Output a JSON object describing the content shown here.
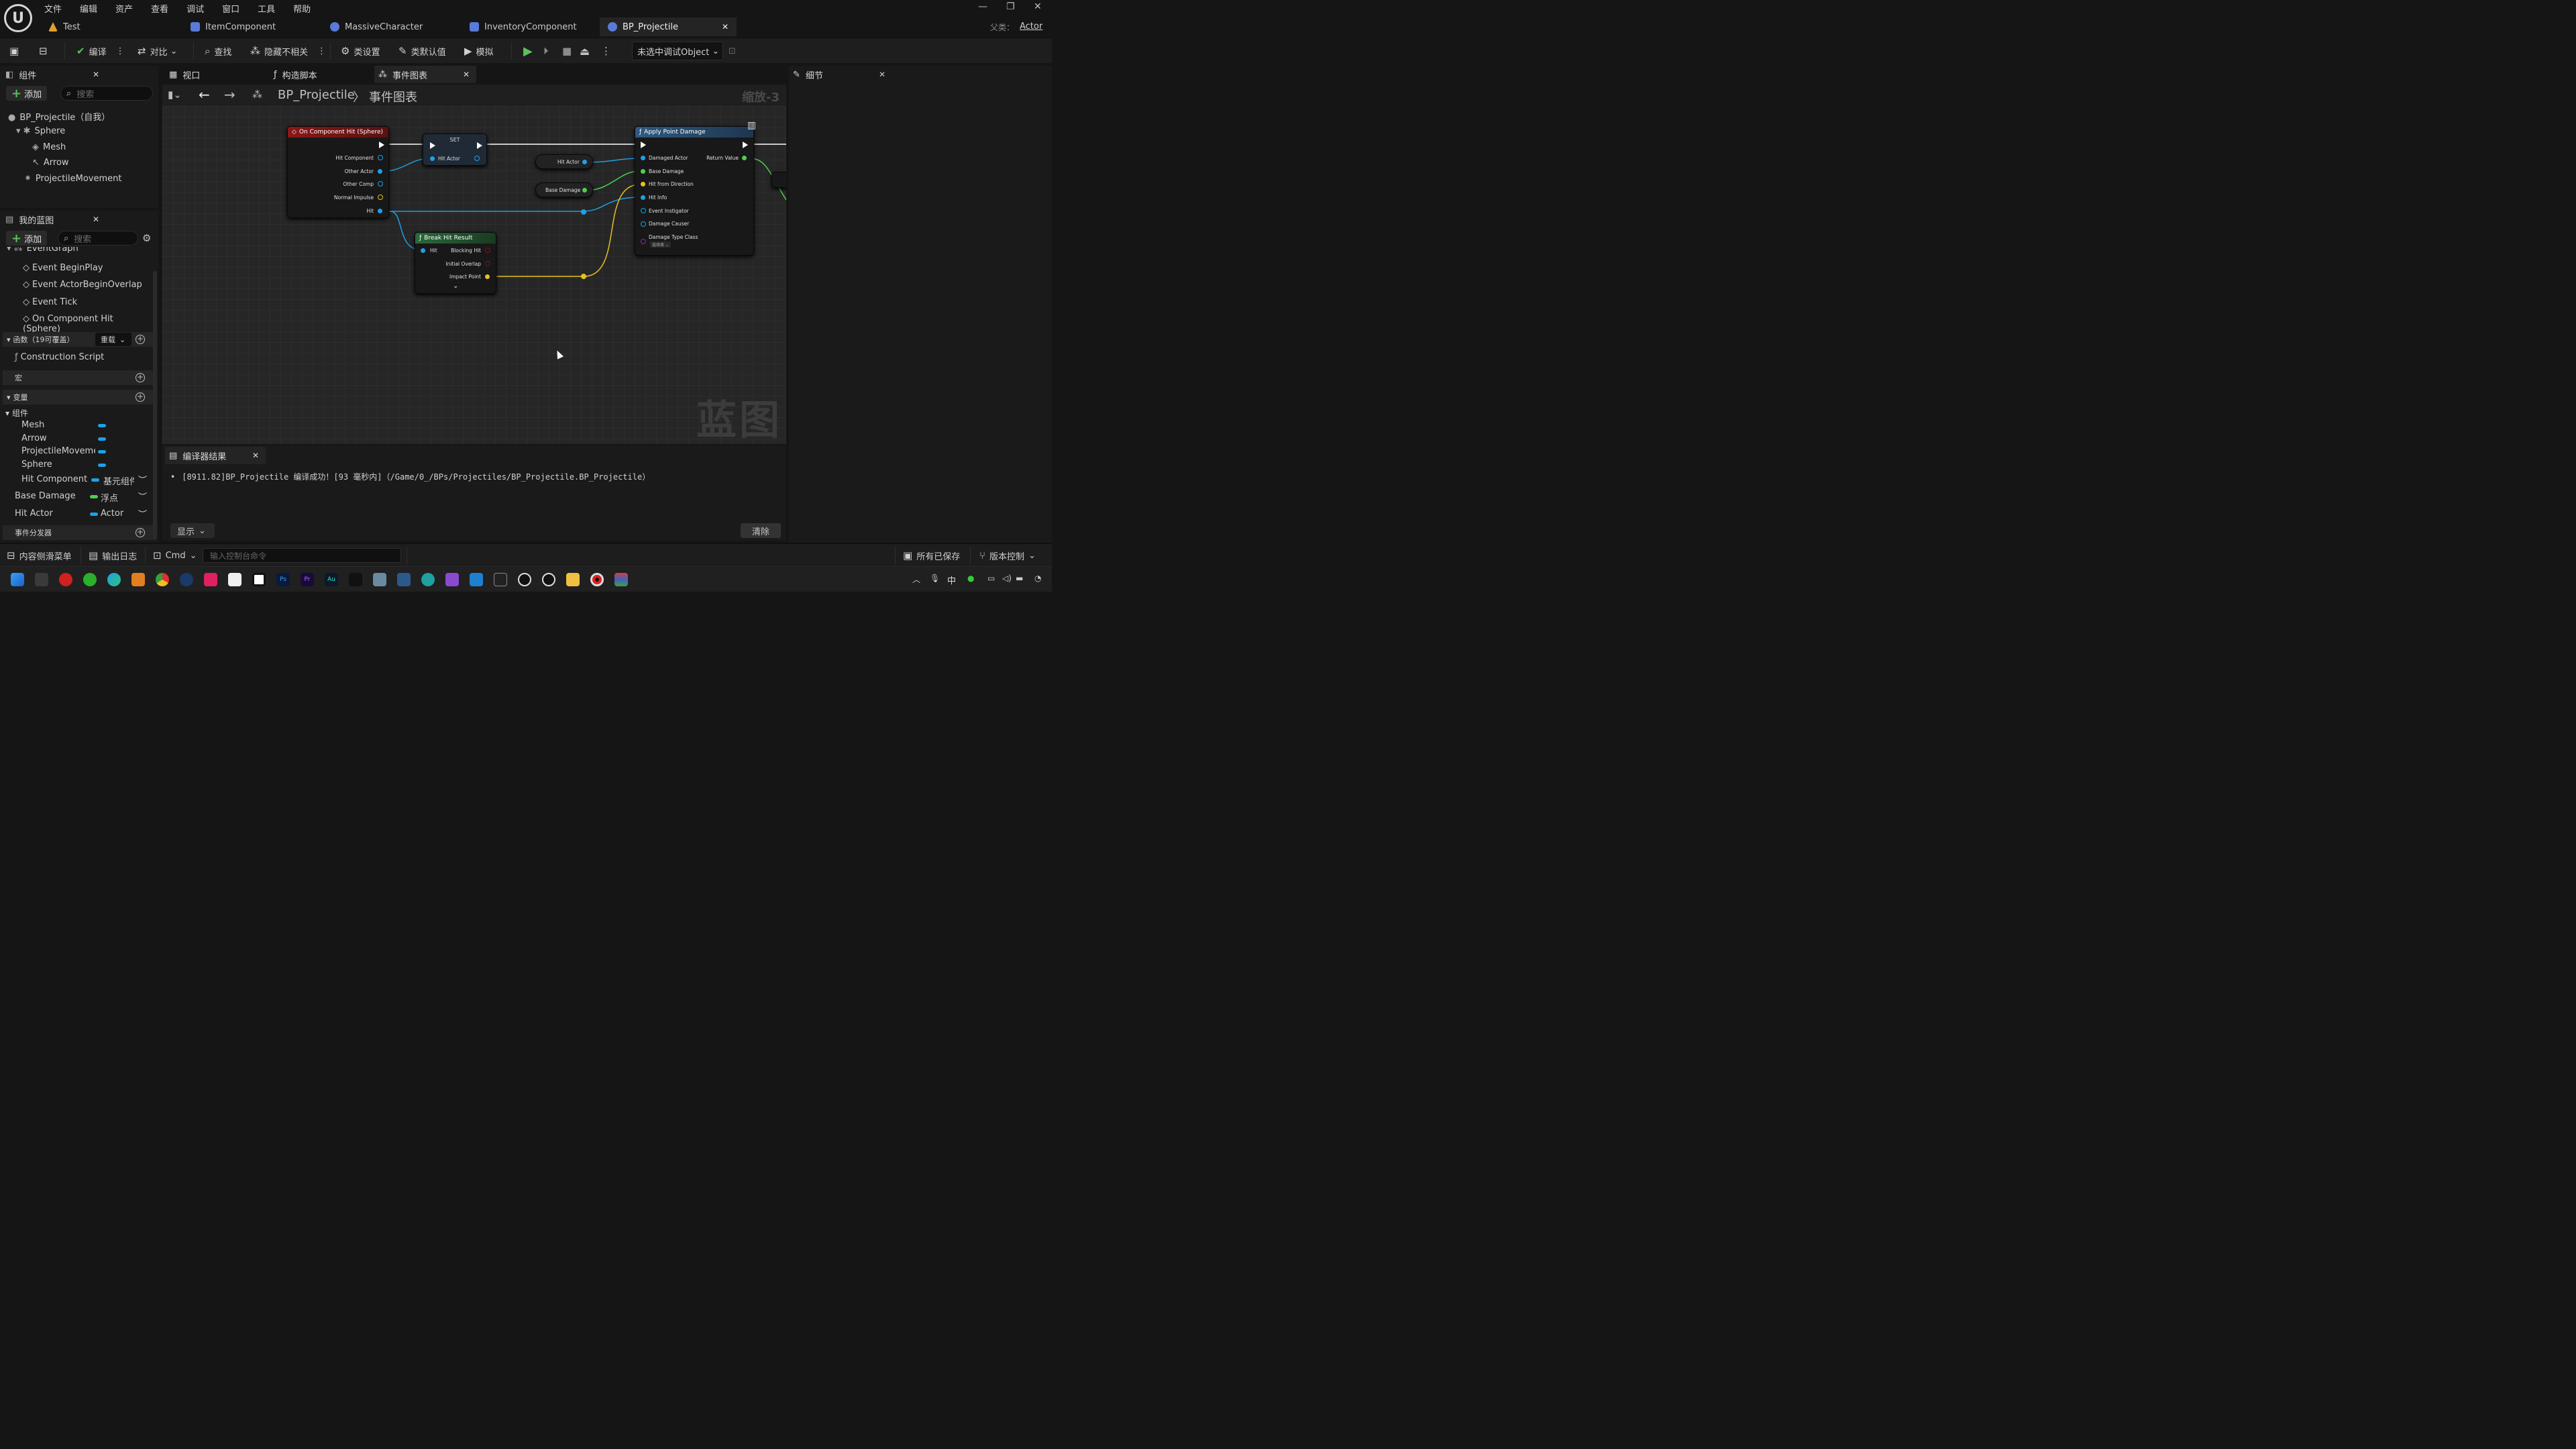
{
  "app": {
    "logo": "U",
    "menu": [
      "文件",
      "编辑",
      "资产",
      "查看",
      "调试",
      "窗口",
      "工具",
      "帮助"
    ],
    "window_controls": [
      "—",
      "❐",
      "✕"
    ],
    "tabs": [
      {
        "label": "Test",
        "icon": "level-icon",
        "color": "#e0a030"
      },
      {
        "label": "ItemComponent",
        "icon": "blueprint-icon",
        "color": "#5a7ad8"
      },
      {
        "label": "MassiveCharacter",
        "icon": "character-icon",
        "color": "#5a7ad8"
      },
      {
        "label": "InventoryComponent",
        "icon": "blueprint-icon",
        "color": "#5a7ad8"
      },
      {
        "label": "BP_Projectile",
        "icon": "actor-icon",
        "color": "#5a7ad8",
        "close": "✕"
      }
    ],
    "parent_class_label": "父类：",
    "parent_class_value": "Actor"
  },
  "toolbar": {
    "compile": "编译",
    "diff": "对比",
    "find": "查找",
    "hide_unrelated": "隐藏不相关",
    "class_settings": "类设置",
    "class_defaults": "类默认值",
    "simulate": "模拟",
    "debug_object": "未选中调试Object"
  },
  "components_panel": {
    "title": "组件",
    "add": "添加",
    "search_placeholder": "搜索",
    "items": [
      "BP_Projectile（自我）",
      "Sphere",
      "Mesh",
      "Arrow",
      "ProjectileMovement"
    ]
  },
  "mybp_panel": {
    "title": "我的蓝图",
    "add": "添加",
    "search_placeholder": "搜索",
    "eventgraph": "EventGraph",
    "events": [
      "Event BeginPlay",
      "Event ActorBeginOverlap",
      "Event Tick",
      "On Component Hit (Sphere)"
    ],
    "functions_label": "函数（19可覆盖）",
    "override": "重载",
    "construction": "Construction Script",
    "macros": "宏",
    "variables": "变量",
    "components_group": "组件",
    "component_vars": [
      "Mesh",
      "Arrow",
      "ProjectileMovemer",
      "Sphere"
    ],
    "var_rows": [
      {
        "name": "Hit Component",
        "type": "基元组件",
        "color": "#1ea0e8"
      },
      {
        "name": "Base Damage",
        "type": "浮点",
        "color": "#4ed04e"
      },
      {
        "name": "Hit Actor",
        "type": "Actor",
        "color": "#1ea0e8"
      }
    ],
    "dispatchers": "事件分发器"
  },
  "editor_tabs": [
    {
      "label": "视口",
      "icon": "viewport-icon"
    },
    {
      "label": "构造脚本",
      "icon": "function-icon"
    },
    {
      "label": "事件图表",
      "icon": "graph-icon",
      "close": "✕"
    }
  ],
  "graph": {
    "breadcrumb_root": "BP_Projectile",
    "breadcrumb_sep": "〉",
    "breadcrumb_leaf": "事件图表",
    "zoom": "缩放-3",
    "watermark": "蓝图",
    "nodes": {
      "hit_event": {
        "title": "On Component Hit (Sphere)",
        "pins": [
          "Hit Component",
          "Other Actor",
          "Other Comp",
          "Normal Impulse",
          "Hit"
        ]
      },
      "set": {
        "title": "SET",
        "pin": "Hit Actor"
      },
      "hit_actor_get": "Hit Actor",
      "base_damage_get": "Base Damage",
      "break_hit": {
        "title": "Break Hit Result",
        "in": "Hit",
        "outs": [
          "Blocking Hit",
          "Initial Overlap",
          "Impact Point"
        ],
        "expand": "⌄"
      },
      "apply_damage": {
        "title": "Apply Point Damage",
        "pins": [
          "Damaged Actor",
          "Base Damage",
          "Hit from Direction",
          "Hit Info",
          "Event Instigator",
          "Damage Causer",
          "Damage Type Class"
        ],
        "return": "Return Value",
        "select": "选择类"
      }
    }
  },
  "details_panel": {
    "title": "细节"
  },
  "output": {
    "title": "编译器结果",
    "message": "[8911.82]BP_Projectile 编译成功！[93 毫秒内]（/Game/0_/BPs/Projectiles/BP_Projectile.BP_Projectile）",
    "show": "显示",
    "clear": "清除"
  },
  "status": {
    "content_drawer": "内容侧滑菜单",
    "output_log": "输出日志",
    "cmd": "Cmd",
    "console_placeholder": "输入控制台命令",
    "all_saved": "所有已保存",
    "source_control": "版本控制"
  },
  "taskbar": {
    "tray_lang": "中",
    "icons": [
      "windows-start-icon",
      "terminal-icon",
      "netease-music-icon",
      "wechat-icon",
      "edge-icon",
      "spider-icon",
      "chrome-icon",
      "steam-icon",
      "app-icon",
      "meta-icon",
      "box-icon",
      "photoshop-icon",
      "premiere-icon",
      "audition-icon",
      "capcut-icon",
      "calculator-icon",
      "notepad-icon",
      "arduino-icon",
      "visual-studio-icon",
      "vscode-icon",
      "epic-icon",
      "unreal-icon",
      "unreal2-icon",
      "folder-icon",
      "record-icon",
      "rar-icon"
    ]
  }
}
